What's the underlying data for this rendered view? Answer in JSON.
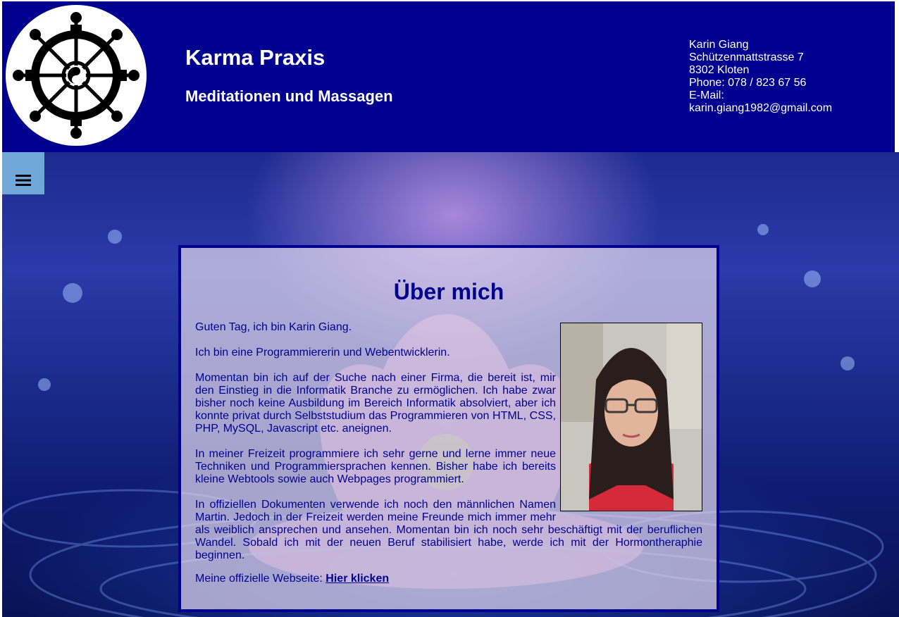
{
  "header": {
    "title": "Karma Praxis",
    "subtitle": "Meditationen und Massagen",
    "logo_icon": "dharma-wheel-icon",
    "contact": {
      "name": "Karin Giang",
      "street": "Schützenmattstrasse 7",
      "city": "8302 Kloten",
      "phone": "Phone: 078 / 823 67 56",
      "email_label": "E-Mail:",
      "email": "karin.giang1982@gmail.com"
    }
  },
  "nav": {
    "menu_icon": "hamburger-menu-icon"
  },
  "content": {
    "title": "Über mich",
    "paragraphs": [
      "Guten Tag, ich bin Karin Giang.",
      "Ich bin eine Programmiererin und Webentwicklerin.",
      "Momentan bin ich auf der Suche nach einer Firma, die bereit ist, mir den Einstieg in die Informatik Branche zu ermöglichen. Ich habe zwar bisher noch keine Ausbildung im Bereich Informatik absolviert, aber ich konnte privat durch Selbststudium das Programmieren von HTML, CSS, PHP, MySQL, Javascript etc. aneignen.",
      "In meiner Freizeit programmiere ich sehr gerne und lerne immer neue Techniken und Programmiersprachen kennen. Bisher habe ich bereits kleine Webtools sowie auch Webpages programmiert.",
      "In offiziellen Dokumenten verwende ich noch den männlichen Namen Martin. Jedoch in der Freizeit werden meine Freunde mich immer mehr als weiblich ansprechen und ansehen. Momentan bin ich noch sehr beschäftigt mit der beruflichen Wandel. Sobald ich mit der neuen Beruf stabilisiert habe, werde ich mit der Hormontheraphie beginnen."
    ],
    "website_label": "Meine offizielle Webseite:",
    "website_link": "Hier klicken"
  },
  "colors": {
    "header_bg": "#01018f",
    "menu_bg": "#6fa7d8",
    "text": "#01018f"
  }
}
